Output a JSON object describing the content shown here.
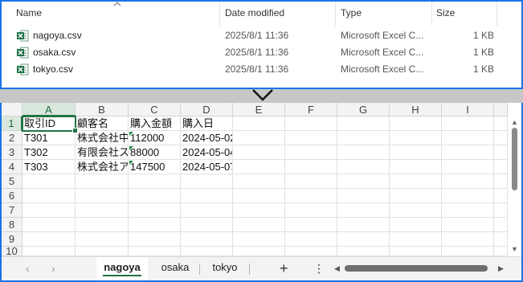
{
  "explorer": {
    "columns": {
      "name": "Name",
      "date": "Date modified",
      "type": "Type",
      "size": "Size"
    },
    "files": [
      {
        "name": "nagoya.csv",
        "date": "2025/8/1 11:36",
        "type": "Microsoft Excel C...",
        "size": "1 KB",
        "icon": "excel-csv-icon"
      },
      {
        "name": "osaka.csv",
        "date": "2025/8/1 11:36",
        "type": "Microsoft Excel C...",
        "size": "1 KB",
        "icon": "excel-csv-icon"
      },
      {
        "name": "tokyo.csv",
        "date": "2025/8/1 11:36",
        "type": "Microsoft Excel C...",
        "size": "1 KB",
        "icon": "excel-csv-icon"
      }
    ]
  },
  "excel": {
    "columns": [
      "A",
      "B",
      "C",
      "D",
      "E",
      "F",
      "G",
      "H",
      "I"
    ],
    "selected_column": "A",
    "selected_row": "1",
    "rows": [
      "1",
      "2",
      "3",
      "4",
      "5",
      "6",
      "7",
      "8",
      "9",
      "10"
    ],
    "cells": {
      "r1": [
        "取引ID",
        "顧客名",
        "購入金額",
        "購入日"
      ],
      "r2": [
        "T301",
        "株式会社中",
        "112000",
        "2024-05-02"
      ],
      "r3": [
        "T302",
        "有限会社ス",
        "88000",
        "2024-05-04"
      ],
      "r4": [
        "T303",
        "株式会社ア",
        "147500",
        "2024-05-07"
      ]
    },
    "sheets": [
      "nagoya",
      "osaka",
      "tokyo"
    ],
    "active_sheet": "nagoya",
    "accent_color": "#217346"
  },
  "colors": {
    "selection_border": "#1a73e8",
    "excel_green": "#217346"
  }
}
